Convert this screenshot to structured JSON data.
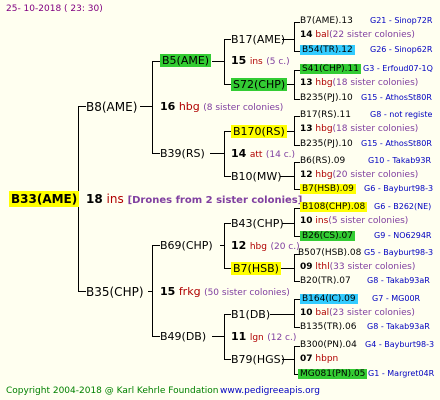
{
  "header": {
    "date_label": "25- 10-2018 ( 23: 30)"
  },
  "footer": {
    "copyright": "Copyright 2004-2018 @ Karl Kehrle Foundation",
    "site": "www.pedigreeapis.org"
  },
  "root": {
    "name": "B33(AME)",
    "gen_num": "18",
    "gen_code": "ins",
    "note": "[Drones from 2 sister colonies]"
  },
  "gen1": [
    {
      "name": "B8(AME)",
      "gen_num": "16",
      "gen_code": "hbg",
      "note": "(8 sister colonies)"
    },
    {
      "name": "B35(CHP)",
      "gen_num": "15",
      "gen_code": "frkg",
      "note": "(50 sister colonies)"
    }
  ],
  "gen2": [
    {
      "name": "B5(AME)",
      "gen_num": "15",
      "gen_code": "ins",
      "note": "(5 c.)"
    },
    {
      "name": "B39(RS)",
      "gen_num": "14",
      "gen_code": "att",
      "note": "(14 c.)"
    },
    {
      "name": "B69(CHP)",
      "gen_num": "12",
      "gen_code": "hbg",
      "note": "(20 c.)"
    },
    {
      "name": "B49(DB)",
      "gen_num": "11",
      "gen_code": "lgn",
      "note": "(12 c.)"
    }
  ],
  "gen3": [
    {
      "name": "B17(AME)"
    },
    {
      "name": "S72(CHP)"
    },
    {
      "name": "B170(RS)"
    },
    {
      "name": "B10(MW)"
    },
    {
      "name": "B43(CHP)"
    },
    {
      "name": "B7(HSB)"
    },
    {
      "name": "B1(DB)"
    },
    {
      "name": "B79(HGS)"
    }
  ],
  "gen4": [
    {
      "name": "B7(AME).13",
      "id": "G21 - Sinop72R"
    },
    {
      "line": "14",
      "code": "bal",
      "note": "(22 sister colonies)"
    },
    {
      "name": "B54(TR).12",
      "id": "G26 - Sinop62R"
    },
    {
      "name": "S41(CHP).11",
      "id": "G3 - Erfoud07-1Q"
    },
    {
      "line": "13",
      "code": "hbg",
      "note": "(18 sister colonies)"
    },
    {
      "name": "B235(PJ).10",
      "id": "G15 - AthosSt80R"
    },
    {
      "name": "B17(RS).11",
      "id": "G8 - not registe"
    },
    {
      "line": "13",
      "code": "hbg",
      "note": "(18 sister colonies)"
    },
    {
      "name": "B235(PJ).10",
      "id": "G15 - AthosSt80R"
    },
    {
      "name": "B6(RS).09",
      "id": "G10 - Takab93R"
    },
    {
      "line": "12",
      "code": "hbg",
      "note": "(20 sister colonies)"
    },
    {
      "name": "B7(HSB).09",
      "id": "G6 - Bayburt98-3"
    },
    {
      "name": "B108(CHP).08",
      "id": "G6 - B262(NE)"
    },
    {
      "line": "10",
      "code": "ins",
      "note": "(5 sister colonies)"
    },
    {
      "name": "B26(CS).07",
      "id": "G9 - NO6294R"
    },
    {
      "name": "B507(HSB).08",
      "id": "G5 - Bayburt98-3"
    },
    {
      "line": "09",
      "code": "lthl",
      "note": "(33 sister colonies)"
    },
    {
      "name": "B20(TR).07",
      "id": "G8 - Takab93aR"
    },
    {
      "name": "B164(IC).09",
      "id": "G7 - MG00R"
    },
    {
      "line": "10",
      "code": "bal",
      "note": "(23 sister colonies)"
    },
    {
      "name": "B135(TR).06",
      "id": "G8 - Takab93aR"
    },
    {
      "name": "B300(PN).04",
      "id": "G4 - Bayburt98-3"
    },
    {
      "line": "07",
      "code": "hbpn",
      "note": ""
    },
    {
      "name": "MG081(PN).05",
      "id": "G1 - Margret04R"
    }
  ]
}
